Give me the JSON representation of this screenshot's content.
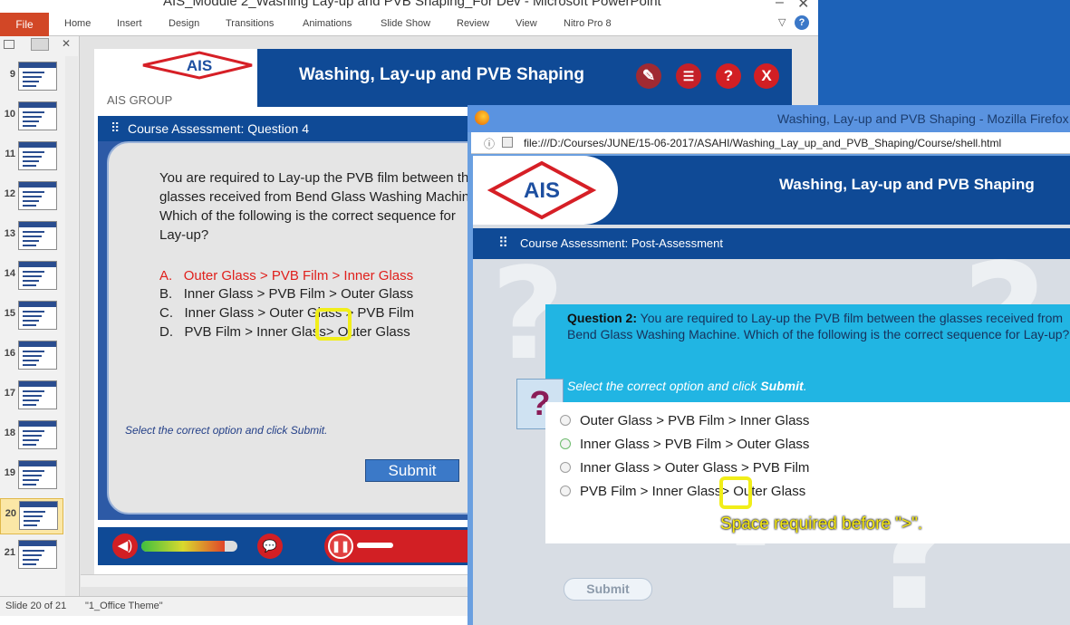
{
  "ppt": {
    "window_title": "AIS_Module 2_Washing Lay-up and PVB Shaping_For Dev - Microsoft PowerPoint",
    "file_tab": "File",
    "ribbon_tabs": [
      "Home",
      "Insert",
      "Design",
      "Transitions",
      "Animations",
      "Slide Show",
      "Review",
      "View",
      "Nitro Pro 8"
    ],
    "thumbnails": [
      "9",
      "10",
      "11",
      "12",
      "13",
      "14",
      "15",
      "16",
      "17",
      "18",
      "19",
      "20",
      "21"
    ],
    "selected_slide": "20",
    "status": {
      "slide_info": "Slide 20 of 21",
      "theme": "\"1_Office Theme\""
    },
    "slide": {
      "brand": "AIS",
      "brand_group": "AIS GROUP",
      "title": "Washing, Lay-up and PVB Shaping",
      "question_bar": "Course Assessment: Question 4",
      "question": "You are required to Lay-up the PVB film between the glasses received from Bend Glass Washing Machine. Which of the following is the correct sequence for Lay-up?",
      "options": [
        {
          "letter": "A.",
          "text": "Outer Glass > PVB Film > Inner Glass",
          "color": "#e0201c"
        },
        {
          "letter": "B.",
          "text": "Inner Glass > PVB Film > Outer Glass",
          "color": "#222222"
        },
        {
          "letter": "C.",
          "text": "Inner Glass > Outer Glass > PVB Film",
          "color": "#222222"
        },
        {
          "letter": "D.",
          "text": "PVB Film > Inner Glass> Outer Glass",
          "color": "#222222"
        }
      ],
      "submit": "Submit",
      "instruction": "Select the correct option and click Submit.",
      "header_buttons": [
        "?",
        "X"
      ]
    }
  },
  "firefox": {
    "window_title": "Washing, Lay-up and PVB Shaping - Mozilla Firefox",
    "url": "file:///D:/Courses/JUNE/15-06-2017/ASAHI/Washing_Lay_up_and_PVB_Shaping/Course/shell.html",
    "brand": "AIS",
    "header_title": "Washing, Lay-up and PVB Shaping",
    "question_bar": "Course Assessment: Post-Assessment",
    "question_label": "Question 2:",
    "question": "You are required to Lay-up the PVB film between the glasses received from Bend Glass Washing Machine. Which of the following is the correct sequence for Lay-up?",
    "instruction_prefix": "Select the correct option and click ",
    "instruction_bold": "Submit",
    "instruction_suffix": ".",
    "question_icon": "?",
    "options": [
      "Outer Glass > PVB Film > Inner Glass",
      "Inner Glass > PVB Film > Outer Glass",
      "Inner Glass > Outer Glass > PVB Film",
      "PVB Film > Inner Glass> Outer Glass"
    ],
    "submit": "Submit"
  },
  "annotation": {
    "note": "Space required before \">\".",
    "color": "#f1ee19"
  }
}
